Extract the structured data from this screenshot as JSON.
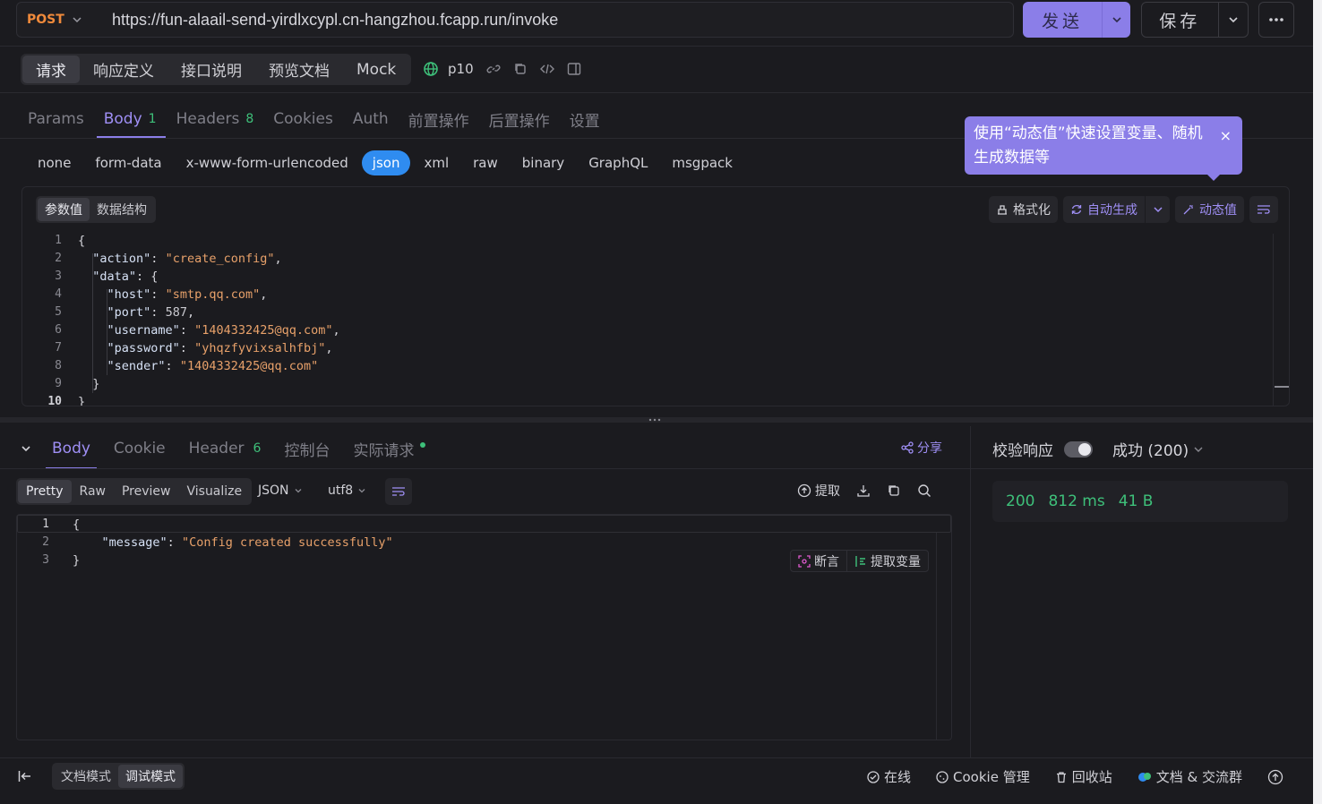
{
  "request": {
    "method": "POST",
    "url": "https://fun-alaail-send-yirdlxcypl.cn-hangzhou.fcapp.run/invoke",
    "send_label": "发送",
    "save_label": "保存"
  },
  "top_tabs": [
    "请求",
    "响应定义",
    "接口说明",
    "预览文档",
    "Mock"
  ],
  "env_name": "p10",
  "param_tabs": {
    "params": "Params",
    "body": "Body",
    "body_count": "1",
    "headers": "Headers",
    "headers_count": "8",
    "cookies": "Cookies",
    "auth": "Auth",
    "pre": "前置操作",
    "post": "后置操作",
    "settings": "设置"
  },
  "body_types": [
    "none",
    "form-data",
    "x-www-form-urlencoded",
    "json",
    "xml",
    "raw",
    "binary",
    "GraphQL",
    "msgpack"
  ],
  "tooltip": {
    "text": "使用“动态值”快速设置变量、随机生成数据等",
    "close": "×"
  },
  "editor": {
    "seg_values": "参数值",
    "seg_schema": "数据结构",
    "format_label": "格式化",
    "autogen_label": "自动生成",
    "dynamic_label": "动态值",
    "line_numbers": [
      "1",
      "2",
      "3",
      "4",
      "5",
      "6",
      "7",
      "8",
      "9",
      "10"
    ]
  },
  "response": {
    "tabs": {
      "body": "Body",
      "cookie": "Cookie",
      "header": "Header",
      "header_count": "6",
      "console": "控制台",
      "actual": "实际请求"
    },
    "share_label": "分享",
    "views": [
      "Pretty",
      "Raw",
      "Preview",
      "Visualize"
    ],
    "format": "JSON",
    "encoding": "utf8",
    "extract_label": "提取",
    "assert_label": "断言",
    "extract_var_label": "提取变量",
    "line_numbers": [
      "1",
      "2",
      "3"
    ],
    "verify_label": "校验响应",
    "status_label": "成功 (200)",
    "status_code": "200",
    "time": "812 ms",
    "size": "41 B"
  },
  "footer": {
    "doc_mode": "文档模式",
    "debug_mode": "调试模式",
    "online": "在线",
    "cookie_mgmt": "Cookie 管理",
    "recycle": "回收站",
    "docs_community": "文档 & 交流群"
  },
  "colors": {
    "accent": "#8b7ee8",
    "success": "#3ec07a",
    "method": "#f08a3b",
    "json_active": "#2f8cf0"
  }
}
